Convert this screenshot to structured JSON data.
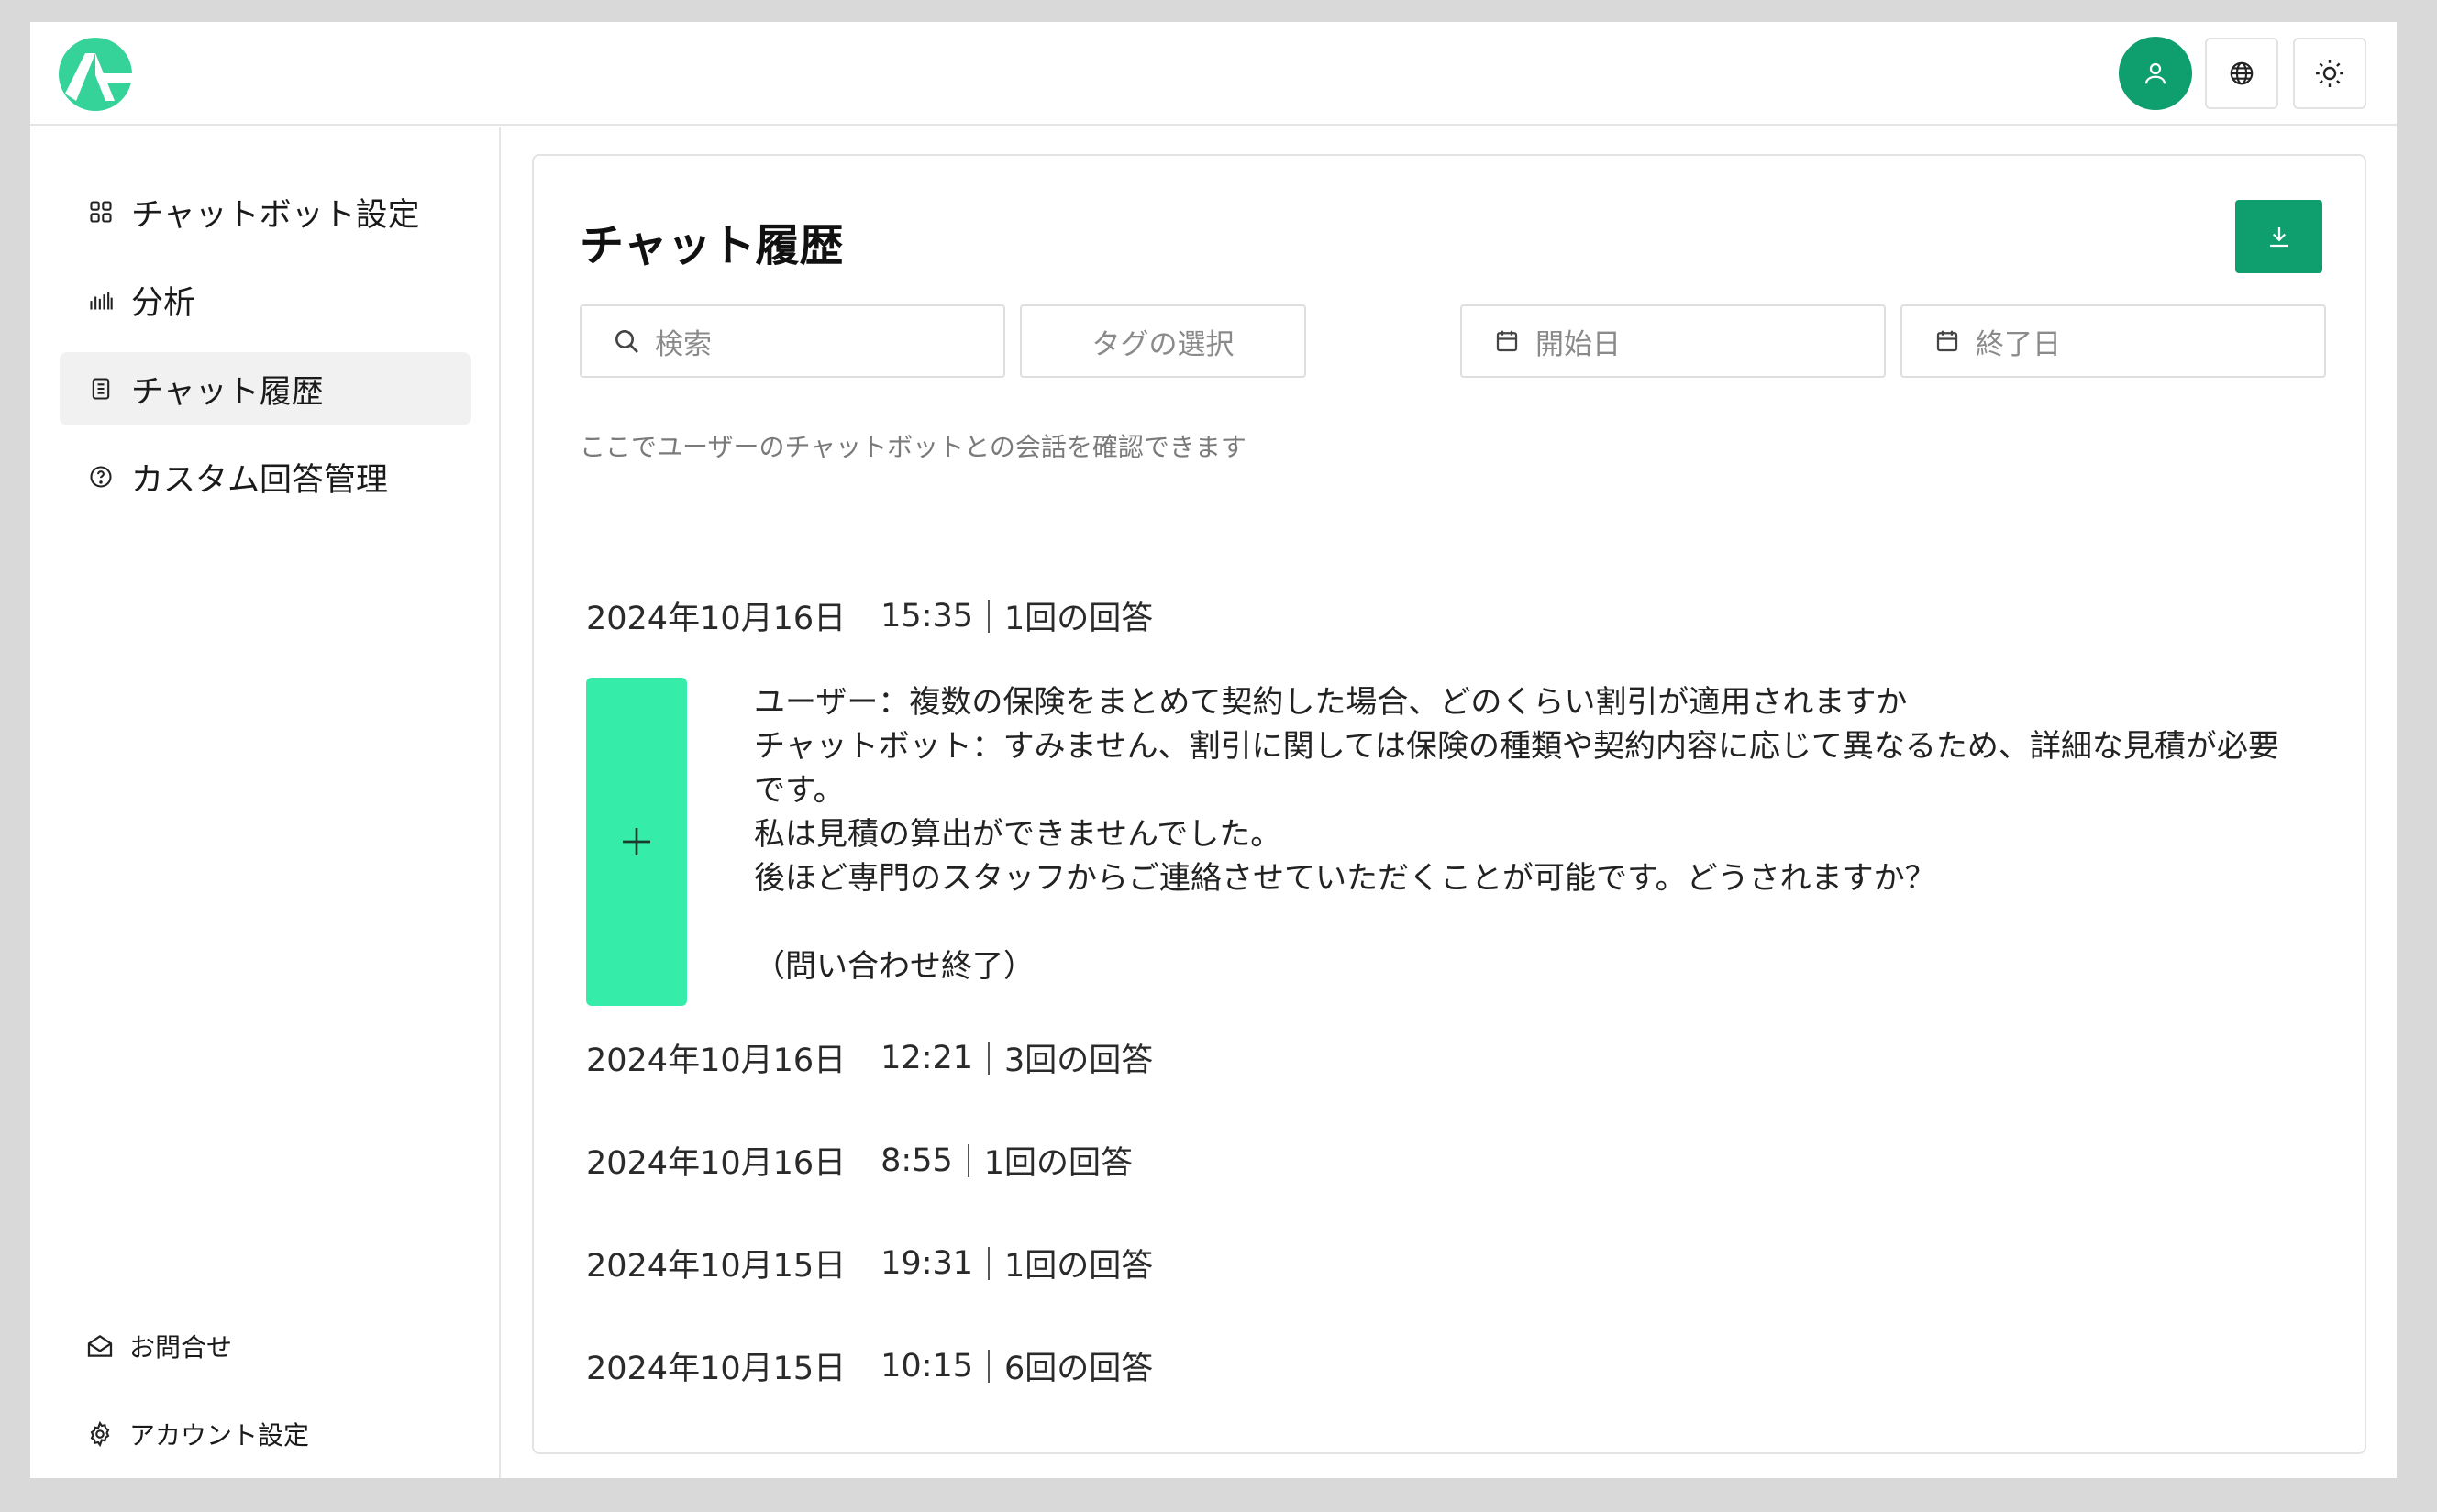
{
  "colors": {
    "accent": "#0f9f6e",
    "expand": "#35eca8",
    "background": "#d9d9d9"
  },
  "topbar": {
    "logo_icon": "brand-logo",
    "avatar_icon": "user-icon",
    "language_icon": "globe-icon",
    "theme_icon": "sun-icon"
  },
  "sidebar": {
    "items": [
      {
        "label": "チャットボット設定",
        "icon": "grid-icon",
        "active": false
      },
      {
        "label": "分析",
        "icon": "bar-chart-icon",
        "active": false
      },
      {
        "label": "チャット履歴",
        "icon": "document-icon",
        "active": true
      },
      {
        "label": "カスタム回答管理",
        "icon": "help-circle-icon",
        "active": false
      }
    ],
    "footer": [
      {
        "label": "お問合せ",
        "icon": "mail-icon"
      },
      {
        "label": "アカウント設定",
        "icon": "gear-icon"
      }
    ]
  },
  "main": {
    "title": "チャット履歴",
    "download_icon": "download-icon",
    "filters": {
      "search_placeholder": "検索",
      "tag_placeholder": "タグの選択",
      "start_placeholder": "開始日",
      "end_placeholder": "終了日"
    },
    "hint": "ここでユーザーのチャットボットとの会話を確認できます",
    "entries": [
      {
        "date": "2024年10月16日",
        "time": "15:35",
        "count": "1回の回答",
        "expanded": true
      },
      {
        "date": "2024年10月16日",
        "time": "12:21",
        "count": "3回の回答",
        "expanded": false
      },
      {
        "date": "2024年10月16日",
        "time": "8:55",
        "count": "1回の回答",
        "expanded": false
      },
      {
        "date": "2024年10月15日",
        "time": "19:31",
        "count": "1回の回答",
        "expanded": false
      },
      {
        "date": "2024年10月15日",
        "time": "10:15",
        "count": "6回の回答",
        "expanded": false
      }
    ],
    "conversation": [
      "ユーザー：複数の保険をまとめて契約した場合、どのくらい割引が適用されますか",
      "チャットボット：すみません、割引に関しては保険の種類や契約内容に応じて異なるため、詳細な見積が必要です。",
      "私は見積の算出ができませんでした。",
      "後ほど専門のスタッフからご連絡させていただくことが可能です。どうされますか？",
      "",
      "（問い合わせ終了）"
    ],
    "expand_icon": "plus-icon"
  }
}
